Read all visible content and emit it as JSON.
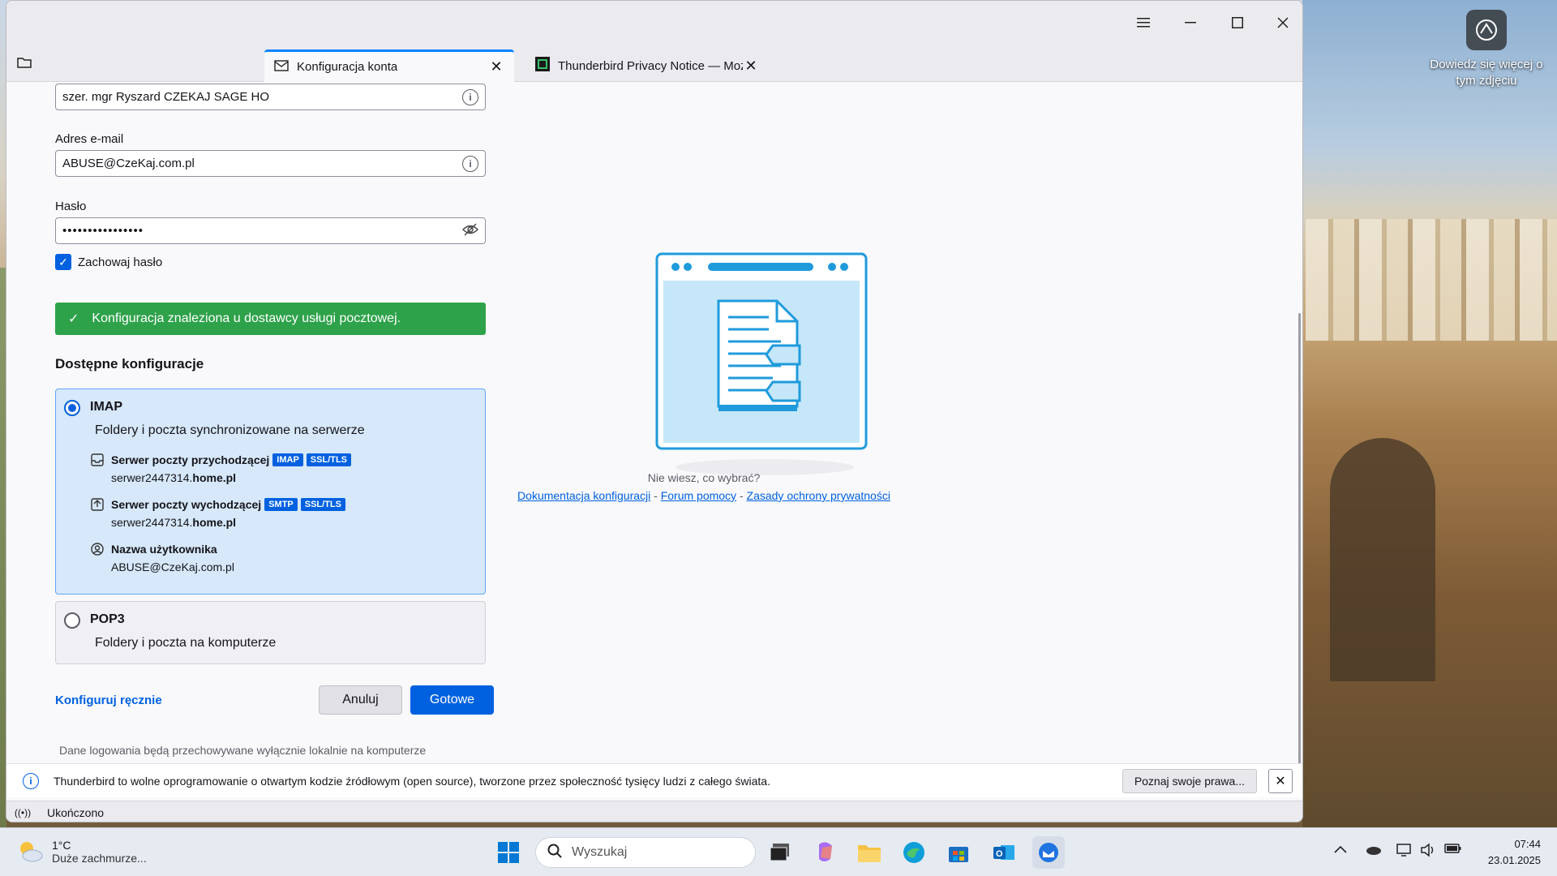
{
  "desktop": {
    "widget_text": "Dowiedz się więcej o tym zdjęciu"
  },
  "window": {
    "menu_icon": "hamburger-icon"
  },
  "tabs": [
    {
      "title": "Konfiguracja konta",
      "icon": "envelope-icon"
    },
    {
      "title": "Thunderbird Privacy Notice — Mozilla",
      "icon": "thunderbird-page-icon"
    }
  ],
  "form": {
    "name_value": "szer. mgr Ryszard CZEKAJ SAGE HO",
    "email_label": "Adres e-mail",
    "email_value": "ABUSE@CzeKaj.com.pl",
    "password_label": "Hasło",
    "password_value": "••••••••••••••••",
    "remember_label": "Zachowaj hasło",
    "remember_checked": true,
    "success_text": "Konfiguracja znaleziona u dostawcy usługi pocztowej.",
    "configs_title": "Dostępne konfiguracje",
    "imap": {
      "title": "IMAP",
      "desc": "Foldery i poczta synchronizowane na serwerze",
      "incoming_label": "Serwer poczty przychodzącej",
      "incoming_badges": [
        "IMAP",
        "SSL/TLS"
      ],
      "incoming_host_prefix": "serwer2447314.",
      "incoming_host_bold": "home.pl",
      "outgoing_label": "Serwer poczty wychodzącej",
      "outgoing_badges": [
        "SMTP",
        "SSL/TLS"
      ],
      "outgoing_host_prefix": "serwer2447314.",
      "outgoing_host_bold": "home.pl",
      "username_label": "Nazwa użytkownika",
      "username_value": "ABUSE@CzeKaj.com.pl"
    },
    "pop3": {
      "title": "POP3",
      "desc": "Foldery i poczta na komputerze"
    },
    "manual_link": "Konfiguruj ręcznie",
    "cancel_label": "Anuluj",
    "done_label": "Gotowe",
    "footer_note": "Dane logowania będą przechowywane wyłącznie lokalnie na komputerze"
  },
  "help": {
    "question": "Nie wiesz, co wybrać?",
    "link_docs": "Dokumentacja konfiguracji",
    "link_forum": "Forum pomocy",
    "link_privacy": "Zasady ochrony prywatności",
    "sep": "-"
  },
  "notice": {
    "text": "Thunderbird to wolne oprogramowanie o otwartym kodzie źródłowym (open source), tworzone przez społeczność tysięcy ludzi z całego świata.",
    "button": "Poznaj swoje prawa...",
    "close": "✕"
  },
  "status": {
    "text": "Ukończono"
  },
  "taskbar": {
    "temp": "1°C",
    "weather": "Duże zachmurze...",
    "search_placeholder": "Wyszukaj",
    "time": "07:44",
    "date": "23.01.2025"
  },
  "colors": {
    "accent": "#0061e0",
    "success": "#2ea24a",
    "imap_bg": "#d6e8f9"
  }
}
